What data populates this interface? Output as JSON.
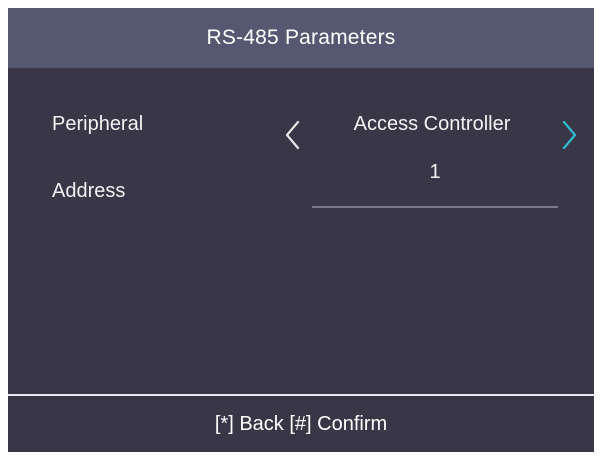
{
  "header": {
    "title": "RS-485 Parameters"
  },
  "rows": {
    "peripheral": {
      "label": "Peripheral",
      "value": "Access Controller",
      "prev_icon": "chevron-left-icon",
      "next_icon": "chevron-right-icon"
    },
    "address": {
      "label": "Address",
      "value": "1"
    }
  },
  "footer": {
    "hint": "[*] Back [#] Confirm"
  },
  "colors": {
    "background": "#383647",
    "header": "#565770",
    "text": "#f2f2f2",
    "chevron_left": "#e6e6e6",
    "chevron_right_accent": "#2fb8c8",
    "underline": "#7a7a8c"
  }
}
